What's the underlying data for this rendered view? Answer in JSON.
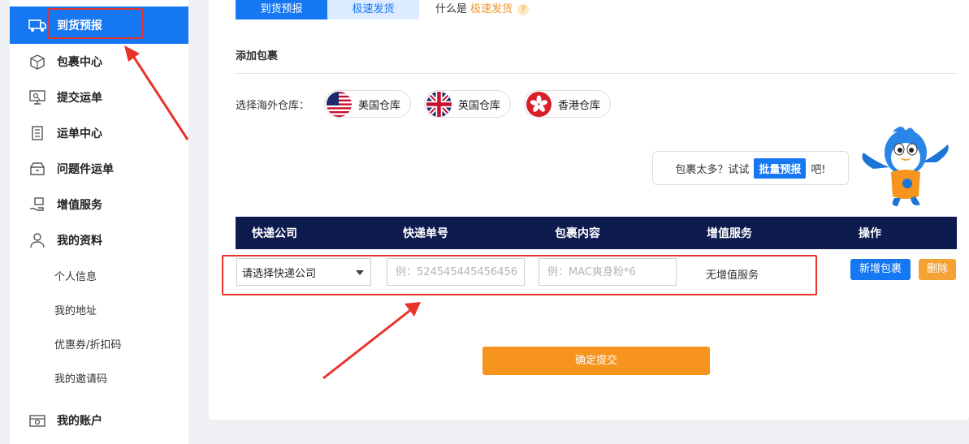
{
  "sidebar": {
    "items": [
      {
        "label": "到货预报",
        "icon": "delivery-truck-icon"
      },
      {
        "label": "包裹中心",
        "icon": "package-box-icon"
      },
      {
        "label": "提交运单",
        "icon": "monitor-icon"
      },
      {
        "label": "运单中心",
        "icon": "clipboard-list-icon"
      },
      {
        "label": "问题件运单",
        "icon": "open-box-icon"
      },
      {
        "label": "增值服务",
        "icon": "hand-package-icon"
      },
      {
        "label": "我的资料",
        "icon": "user-icon"
      }
    ],
    "sub_items": [
      "个人信息",
      "我的地址",
      "优惠券/折扣码",
      "我的邀请码"
    ],
    "account": {
      "label": "我的账户",
      "icon": "wallet-icon"
    }
  },
  "tabs": [
    {
      "label": "到货预报"
    },
    {
      "label": "极速发货"
    }
  ],
  "what_is": {
    "prefix": "什么是",
    "link": "极速发货",
    "help": "?"
  },
  "section_title": "添加包裹",
  "warehouse": {
    "label": "选择海外仓库：",
    "options": [
      {
        "label": "美国仓库",
        "flag": "us-flag-icon"
      },
      {
        "label": "英国仓库",
        "flag": "uk-flag-icon"
      },
      {
        "label": "香港仓库",
        "flag": "hk-flag-icon"
      }
    ]
  },
  "tip": {
    "prefix": "包裹太多？试试",
    "button": "批量预报",
    "suffix": "吧!"
  },
  "table": {
    "headers": [
      "快递公司",
      "快递单号",
      "包裹内容",
      "增值服务",
      "操作"
    ],
    "row": {
      "courier_select": "请选择快递公司",
      "tracking_placeholder": "例：524545445456456",
      "content_placeholder": "例：MAC爽身粉*6",
      "value_added": "无增值服务",
      "add_button": "新增包裹",
      "delete_button": "删除"
    }
  },
  "submit_label": "确定提交",
  "colors": {
    "primary": "#1677f2",
    "header_navy": "#0e1b4f",
    "orange": "#f7941d",
    "annotation_red": "#e8322a"
  }
}
